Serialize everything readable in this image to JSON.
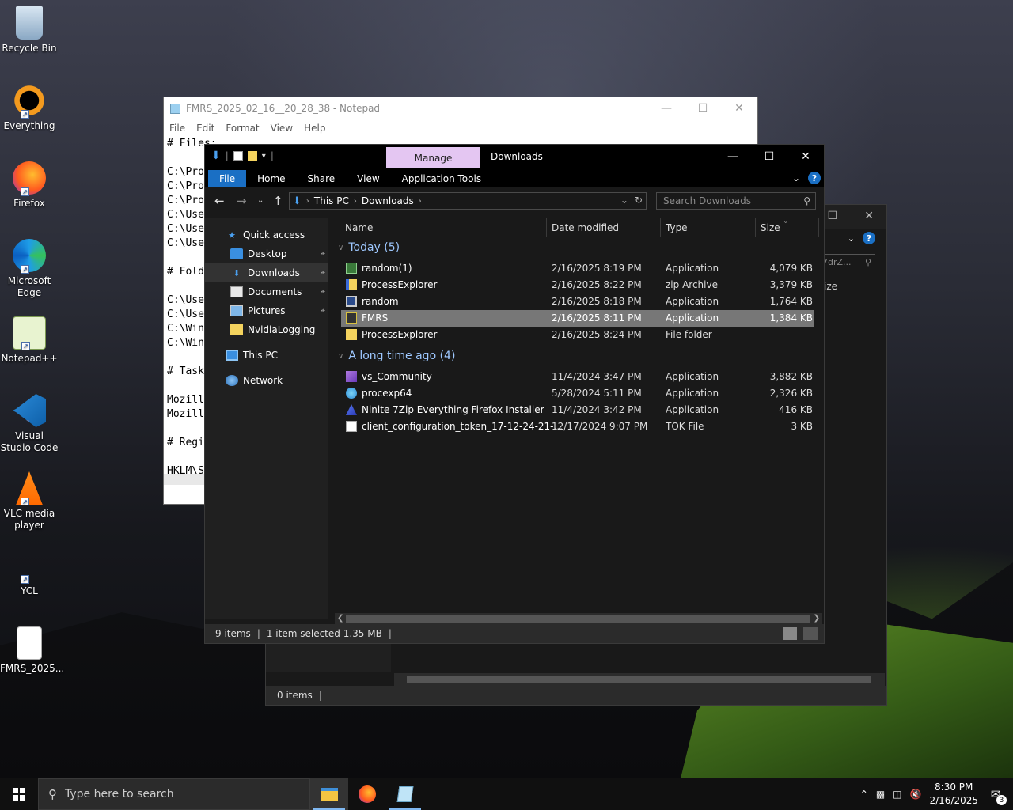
{
  "desktop": {
    "icons": [
      {
        "label": "Recycle Bin",
        "icon": "recycle-bin-icon"
      },
      {
        "label": "Everything",
        "icon": "everything-search-icon"
      },
      {
        "label": "Firefox",
        "icon": "firefox-icon"
      },
      {
        "label": "Microsoft Edge",
        "icon": "edge-icon"
      },
      {
        "label": "Notepad++",
        "icon": "notepadpp-icon"
      },
      {
        "label": "Visual Studio Code",
        "icon": "vscode-icon"
      },
      {
        "label": "VLC media player",
        "icon": "vlc-icon"
      },
      {
        "label": "YCL",
        "icon": "shortcut-icon"
      },
      {
        "label": "FMRS_2025...",
        "icon": "text-file-icon"
      }
    ]
  },
  "notepad": {
    "title": "FMRS_2025_02_16__20_28_38 - Notepad",
    "menu": [
      "File",
      "Edit",
      "Format",
      "View",
      "Help"
    ],
    "lines": [
      "# Files:",
      "",
      "C:\\Pro",
      "C:\\Pro",
      "C:\\Pro",
      "C:\\Use",
      "C:\\Use",
      "C:\\Use",
      "",
      "# Fold",
      "",
      "C:\\Use",
      "C:\\Use",
      "C:\\Win",
      "C:\\Win",
      "",
      "# Task",
      "",
      "Mozill",
      "Mozill",
      "",
      "# Regi",
      "",
      "HKLM\\S"
    ]
  },
  "bg_explorer": {
    "search_placeholder": "7drZ...",
    "size_header": "ize",
    "status_items": "0 items"
  },
  "explorer": {
    "qat_sep": "|",
    "manage_tab": "Manage",
    "caption": "Downloads",
    "ribbon_tabs": [
      "File",
      "Home",
      "Share",
      "View",
      "Application Tools"
    ],
    "help_label": "?",
    "breadcrumb": [
      "This PC",
      "Downloads"
    ],
    "search_placeholder": "Search Downloads",
    "nav": [
      {
        "label": "Quick access",
        "icon": "star-icon",
        "pinned": false,
        "indent": 0
      },
      {
        "label": "Desktop",
        "icon": "desktop-folder-icon",
        "pinned": true,
        "indent": 1
      },
      {
        "label": "Downloads",
        "icon": "downloads-folder-icon",
        "pinned": true,
        "indent": 1,
        "selected": true
      },
      {
        "label": "Documents",
        "icon": "documents-folder-icon",
        "pinned": true,
        "indent": 1
      },
      {
        "label": "Pictures",
        "icon": "pictures-folder-icon",
        "pinned": true,
        "indent": 1
      },
      {
        "label": "NvidiaLogging",
        "icon": "folder-icon",
        "pinned": false,
        "indent": 1
      },
      {
        "label": "This PC",
        "icon": "this-pc-icon",
        "pinned": false,
        "indent": 0
      },
      {
        "label": "Network",
        "icon": "network-icon",
        "pinned": false,
        "indent": 0
      }
    ],
    "columns": {
      "name": "Name",
      "date": "Date modified",
      "type": "Type",
      "size": "Size"
    },
    "groups": [
      {
        "label": "Today (5)",
        "files": [
          {
            "name": "random(1)",
            "date": "2/16/2025 8:19 PM",
            "type": "Application",
            "size": "4,079 KB",
            "icon": "app-icon",
            "selected": false
          },
          {
            "name": "ProcessExplorer",
            "date": "2/16/2025 8:22 PM",
            "type": "zip Archive",
            "size": "3,379 KB",
            "icon": "zip-icon",
            "selected": false
          },
          {
            "name": "random",
            "date": "2/16/2025 8:18 PM",
            "type": "Application",
            "size": "1,764 KB",
            "icon": "app-window-icon",
            "selected": false
          },
          {
            "name": "FMRS",
            "date": "2/16/2025 8:11 PM",
            "type": "Application",
            "size": "1,384 KB",
            "icon": "fmrs-app-icon",
            "selected": true
          },
          {
            "name": "ProcessExplorer",
            "date": "2/16/2025 8:24 PM",
            "type": "File folder",
            "size": "",
            "icon": "folder-icon",
            "selected": false
          }
        ]
      },
      {
        "label": "A long time ago (4)",
        "files": [
          {
            "name": "vs_Community",
            "date": "11/4/2024 3:47 PM",
            "type": "Application",
            "size": "3,882 KB",
            "icon": "visual-studio-icon",
            "selected": false
          },
          {
            "name": "procexp64",
            "date": "5/28/2024 5:11 PM",
            "type": "Application",
            "size": "2,326 KB",
            "icon": "procexp-icon",
            "selected": false
          },
          {
            "name": "Ninite 7Zip Everything Firefox Installer",
            "date": "11/4/2024 3:42 PM",
            "type": "Application",
            "size": "416 KB",
            "icon": "ninite-icon",
            "selected": false
          },
          {
            "name": "client_configuration_token_17-12-24-21-...",
            "date": "12/17/2024 9:07 PM",
            "type": "TOK File",
            "size": "3 KB",
            "icon": "blank-file-icon",
            "selected": false
          }
        ]
      }
    ],
    "status": {
      "items": "9 items",
      "selected": "1 item selected  1.35 MB"
    }
  },
  "taskbar": {
    "search_placeholder": "Type here to search",
    "apps": [
      "file-explorer-icon",
      "firefox-icon",
      "notepad-icon"
    ],
    "time": "8:30 PM",
    "date": "2/16/2025",
    "notifications": "3"
  },
  "colors": {
    "accent": "#1a6fc4",
    "manage_tab": "#e4c6f2",
    "selection": "#777777",
    "group_header": "#9ec8ff"
  }
}
